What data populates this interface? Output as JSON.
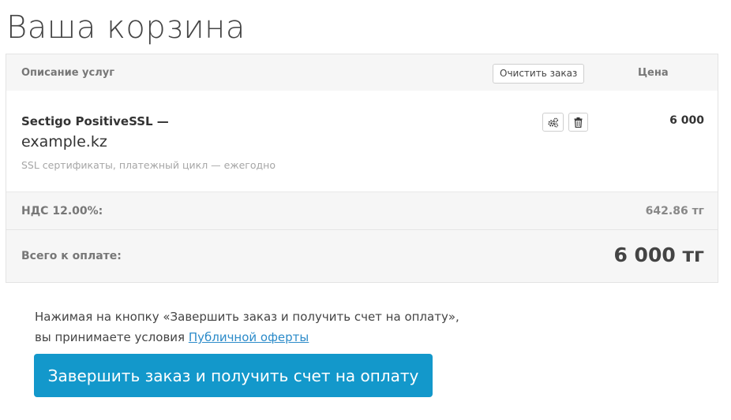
{
  "page": {
    "title": "Ваша корзина"
  },
  "cart": {
    "header": {
      "description_label": "Описание услуг",
      "clear_button": "Очистить заказ",
      "price_label": "Цена"
    },
    "item": {
      "name": "Sectigo PositiveSSL —",
      "domain": "example.kz",
      "meta": "SSL сертификаты, платежный цикл — ежегодно",
      "price": "6 000",
      "config_icon": "gears-icon",
      "remove_icon": "trash-icon"
    },
    "tax": {
      "label": "НДС 12.00%:",
      "value": "642.86 тг"
    },
    "total": {
      "label": "Всего к оплате:",
      "value": "6 000 тг"
    }
  },
  "terms": {
    "line1": "Нажимая на кнопку «Завершить заказ и получить счет на оплату»,",
    "line2_prefix": "вы принимаете условия ",
    "link": "Публичной оферты"
  },
  "submit_button": "Завершить заказ и получить счет на оплату",
  "colors": {
    "primary": "#1398cb",
    "link": "#2c8bc9",
    "row_bg": "#f6f6f6"
  }
}
